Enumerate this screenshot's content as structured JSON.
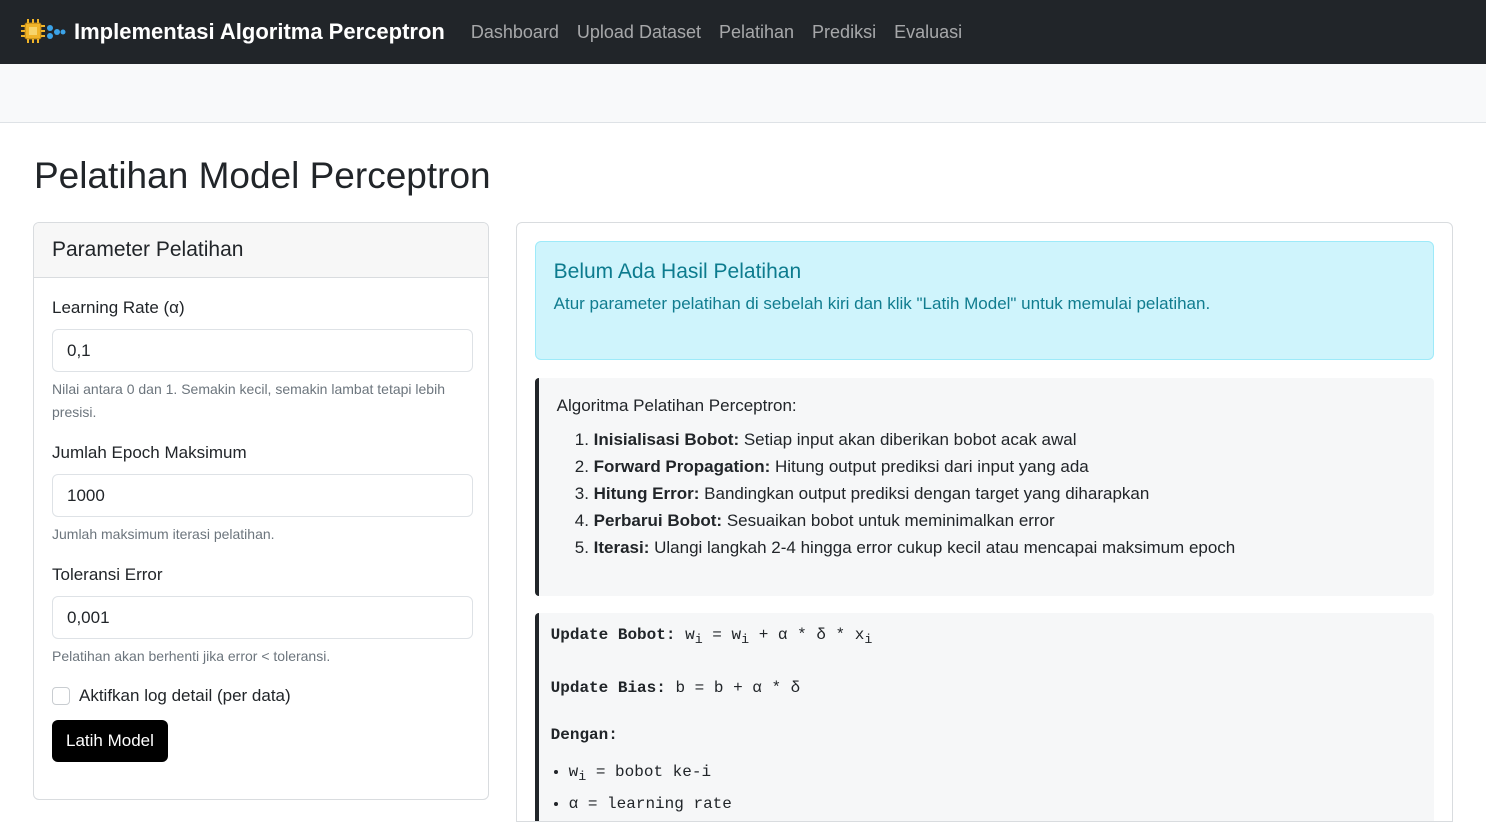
{
  "navbar": {
    "brand": "Implementasi Algoritma Perceptron",
    "links": [
      "Dashboard",
      "Upload Dataset",
      "Pelatihan",
      "Prediksi",
      "Evaluasi"
    ]
  },
  "page": {
    "title": "Pelatihan Model Perceptron"
  },
  "params": {
    "header": "Parameter Pelatihan",
    "learning_rate": {
      "label": "Learning Rate (α)",
      "value": "0,1",
      "help": "Nilai antara 0 dan 1. Semakin kecil, semakin lambat tetapi lebih presisi."
    },
    "epoch": {
      "label": "Jumlah Epoch Maksimum",
      "value": "1000",
      "help": "Jumlah maksimum iterasi pelatihan."
    },
    "tolerance": {
      "label": "Toleransi Error",
      "value": "0,001",
      "help": "Pelatihan akan berhenti jika error < toleransi."
    },
    "log_checkbox": {
      "label": "Aktifkan log detail (per data)",
      "checked": false
    },
    "train_button": "Latih Model"
  },
  "result": {
    "alert_title": "Belum Ada Hasil Pelatihan",
    "alert_text": "Atur parameter pelatihan di sebelah kiri dan klik \"Latih Model\" untuk memulai pelatihan."
  },
  "algorithm": {
    "title": "Algoritma Pelatihan Perceptron:",
    "steps": [
      {
        "name": "Inisialisasi Bobot:",
        "desc": " Setiap input akan diberikan bobot acak awal"
      },
      {
        "name": "Forward Propagation:",
        "desc": " Hitung output prediksi dari input yang ada"
      },
      {
        "name": "Hitung Error:",
        "desc": " Bandingkan output prediksi dengan target yang diharapkan"
      },
      {
        "name": "Perbarui Bobot:",
        "desc": " Sesuaikan bobot untuk meminimalkan error"
      },
      {
        "name": "Iterasi:",
        "desc": " Ulangi langkah 2-4 hingga error cukup kecil atau mencapai maksimum epoch"
      }
    ]
  },
  "formula": {
    "update_weight_label": "Update Bobot:",
    "update_weight_w": "w",
    "update_weight_sub": "i",
    "update_weight_mid": " + α * δ * x",
    "update_bias_label": "Update Bias:",
    "update_bias_expr": " b = b + α * δ",
    "with_label": "Dengan:",
    "item1_w": "w",
    "item1_sub": "i",
    "item1_rest": " = bobot ke-i",
    "item2": "α = learning rate"
  },
  "colors": {
    "navbar_bg": "#212529",
    "alert_bg": "#cff4fc",
    "alert_text": "#087990",
    "button_bg": "#000000"
  }
}
